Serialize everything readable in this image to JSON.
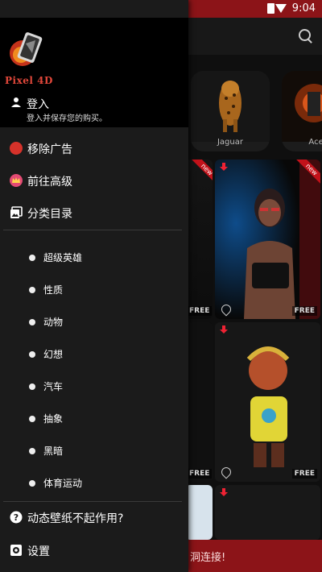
{
  "status_bar": {
    "time": "9:04"
  },
  "drawer": {
    "logo_text": "Pixel 4D",
    "login": {
      "title": "登入",
      "subtitle": "登入并保存您的购买。"
    },
    "menu": [
      {
        "label": "移除广告",
        "icon": "remove-ads-icon"
      },
      {
        "label": "前往高级",
        "icon": "premium-crown-icon"
      },
      {
        "label": "分类目录",
        "icon": "gallery-icon"
      }
    ],
    "categories": [
      "超级英雄",
      "性质",
      "动物",
      "幻想",
      "汽车",
      "抽象",
      "黑暗",
      "体育运动"
    ],
    "footer": [
      {
        "label": "动态壁纸不起作用?",
        "icon": "help-icon"
      },
      {
        "label": "设置",
        "icon": "settings-icon"
      }
    ]
  },
  "background_app": {
    "featured": [
      {
        "label": "Jaguar"
      },
      {
        "label": "Ace of"
      }
    ],
    "badges": {
      "free": "FREE",
      "new": "new"
    },
    "toast_text": "洞连接!"
  },
  "colors": {
    "accent": "#8c1418",
    "drawer_bg": "#1b1b1b",
    "logo_text": "#e0473a"
  }
}
